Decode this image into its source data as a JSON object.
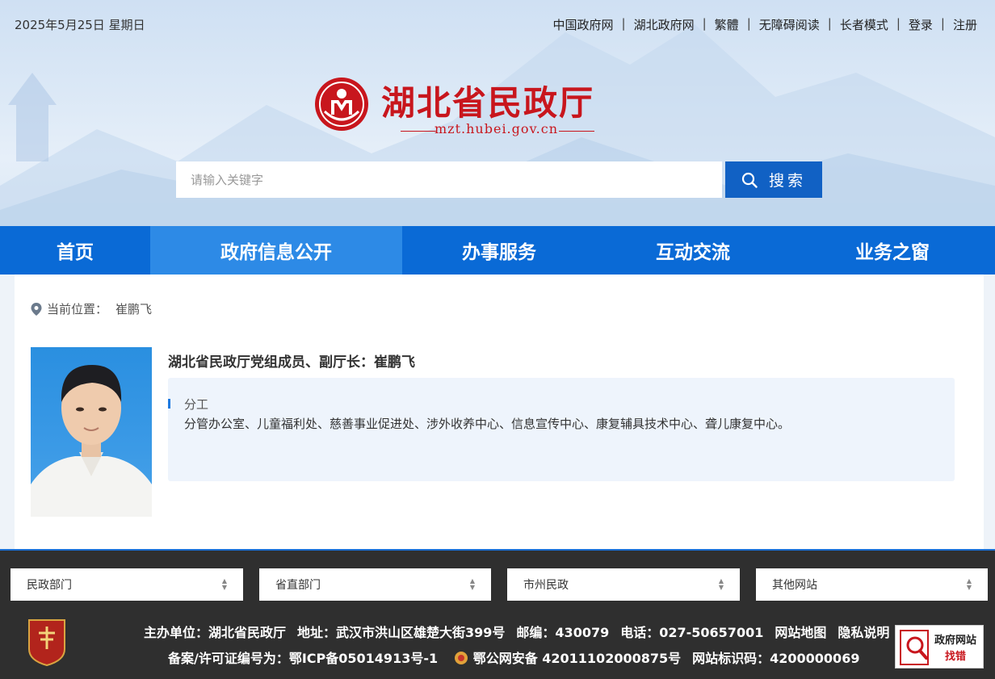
{
  "header": {
    "date": "2025年5月25日 星期日",
    "top_links": [
      "中国政府网",
      "湖北政府网",
      "繁體",
      "无障碍阅读",
      "长者模式",
      "登录",
      "注册"
    ],
    "logo_title": "湖北省民政厅",
    "logo_url": "mzt.hubei.gov.cn",
    "search_placeholder": "请输入关键字",
    "search_button": "搜索"
  },
  "nav": {
    "items": [
      "首页",
      "政府信息公开",
      "办事服务",
      "互动交流",
      "业务之窗"
    ],
    "active": "政府信息公开"
  },
  "breadcrumb": {
    "label": "当前位置：",
    "value": "崔鹏飞"
  },
  "profile": {
    "title": "湖北省民政厅党组成员、副厅长：崔鹏飞",
    "duty_label": "分工",
    "duty_text": "分管办公室、儿童福利处、慈善事业促进处、涉外收养中心、信息宣传中心、康复辅具技术中心、聋儿康复中心。"
  },
  "footer": {
    "selects": [
      "民政部门",
      "省直部门",
      "市州民政",
      "其他网站"
    ],
    "line1": [
      "主办单位：湖北省民政厅",
      "地址：武汉市洪山区雄楚大街399号",
      "邮编：430079",
      "电话：027-50657001",
      "网站地图",
      "隐私说明"
    ],
    "line2": [
      "备案/许可证编号为：鄂ICP备05014913号-1",
      "鄂公网安备 42011102000875号",
      "网站标识码：4200000069"
    ],
    "badge_text": "党政机关",
    "report_line1": "政府网站",
    "report_line2": "找错"
  },
  "colors": {
    "nav_bg": "#0a6ad6",
    "nav_active": "#2d8ae6",
    "brand_red": "#c8161d",
    "footer_bg": "#2f2f2f"
  }
}
